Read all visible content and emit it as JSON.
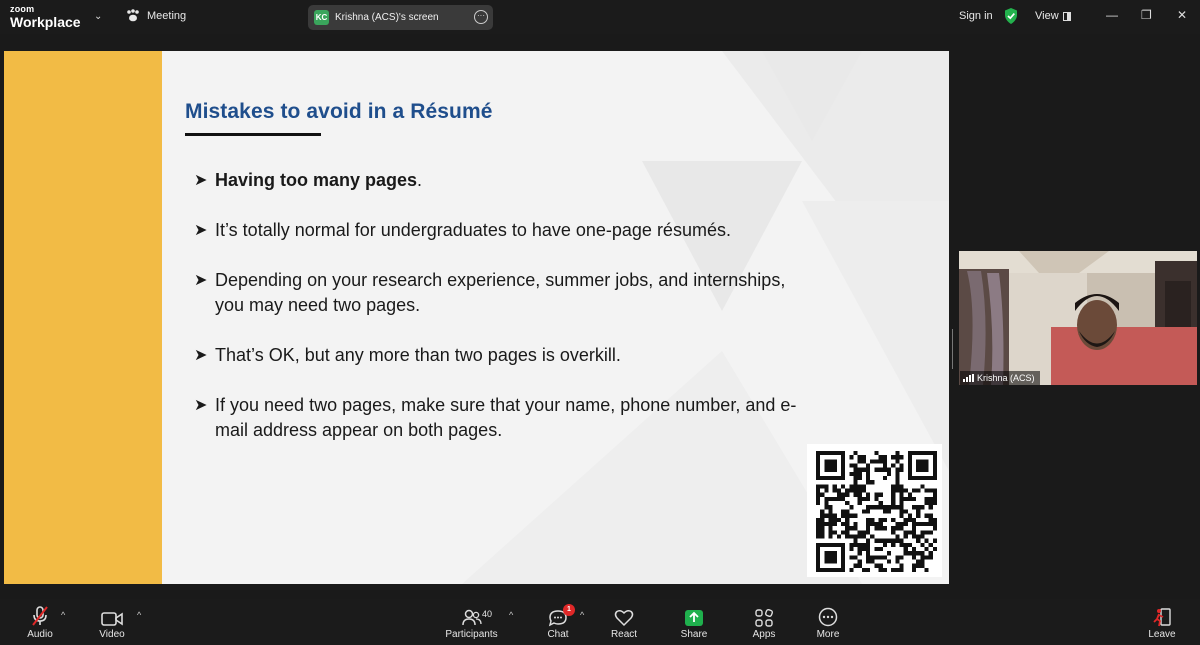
{
  "app": {
    "brand_top": "zoom",
    "brand_bottom": "Workplace",
    "meeting_label": "Meeting",
    "share_initials": "KC",
    "share_label": "Krishna (ACS)'s screen",
    "signin_label": "Sign in",
    "view_label": "View"
  },
  "slide": {
    "title": "Mistakes to avoid in a Résumé",
    "bullets": [
      {
        "bold": "Having too many pages",
        "rest": "."
      },
      {
        "bold": "",
        "rest": "It’s totally normal for undergraduates to have one-page résumés."
      },
      {
        "bold": "",
        "rest": "Depending on your research experience, summer jobs, and internships, you may need two pages."
      },
      {
        "bold": "",
        "rest": "That’s OK, but any more than two pages is overkill."
      },
      {
        "bold": "",
        "rest": "If you need two pages, make sure that your name, phone number, and e-mail address appear on both pages."
      }
    ],
    "accent_color": "#f2bb45",
    "title_color": "#1f4e8c"
  },
  "participant": {
    "name": "Krishna (ACS)"
  },
  "toolbar": {
    "audio": "Audio",
    "video": "Video",
    "participants": "Participants",
    "participants_count": "40",
    "chat": "Chat",
    "chat_badge": "1",
    "react": "React",
    "share": "Share",
    "apps": "Apps",
    "more": "More",
    "leave": "Leave"
  },
  "icons": {
    "meeting": "paw-icon",
    "security": "shield-check-icon",
    "audio": "mic-muted-icon",
    "video": "camera-icon",
    "participants": "people-icon",
    "chat": "chat-bubble-icon",
    "react": "heart-icon",
    "share": "share-arrow-icon",
    "apps": "apps-icon",
    "more": "more-icon",
    "leave": "leave-icon"
  },
  "colors": {
    "share_green": "#1fb04d",
    "shield_green": "#23b14d",
    "muted_red": "#e02828"
  }
}
